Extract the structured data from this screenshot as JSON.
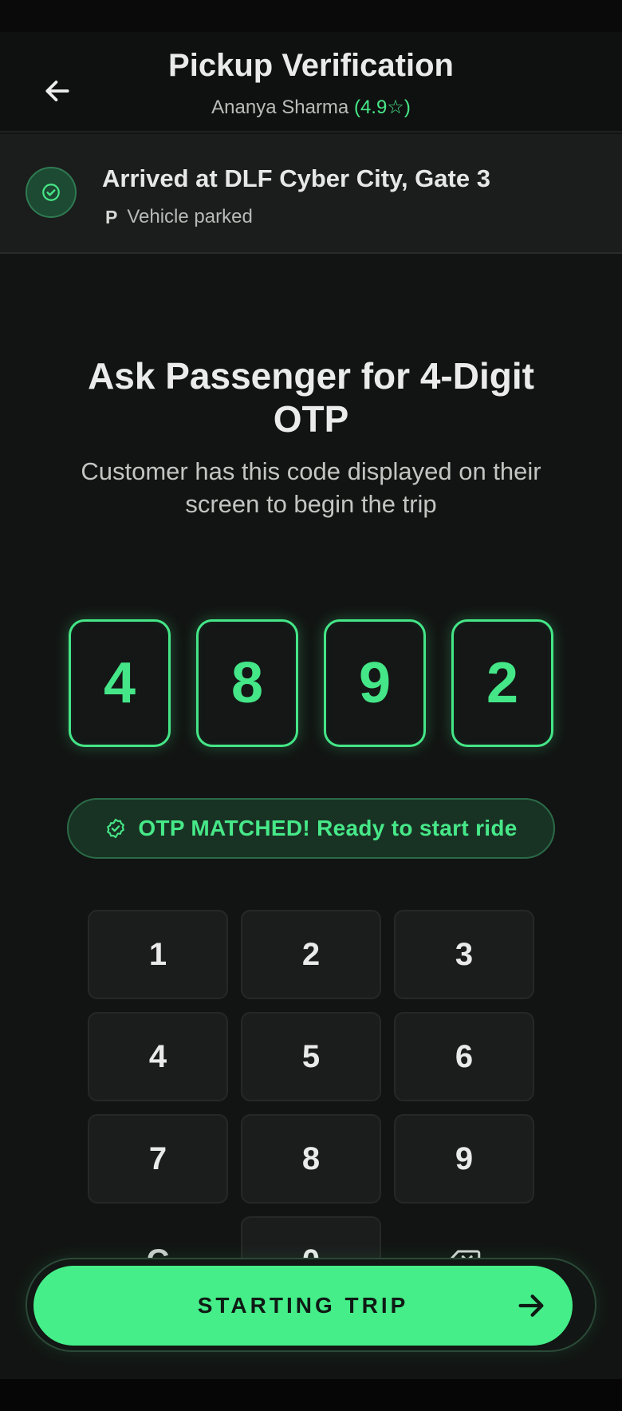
{
  "header": {
    "title": "Pickup Verification",
    "driver_name": "Ananya Sharma",
    "driver_rating": "(4.9☆)"
  },
  "arrival": {
    "title": "Arrived at DLF Cyber City, Gate 3",
    "parking_glyph": "P",
    "status": "Vehicle parked"
  },
  "prompt": {
    "title": "Ask Passenger for 4-Digit OTP",
    "description": "Customer has this code displayed on their screen to begin the trip"
  },
  "otp": {
    "digits": [
      "4",
      "8",
      "9",
      "2"
    ]
  },
  "match": {
    "message": "OTP MATCHED! Ready to start ride"
  },
  "keypad": {
    "keys": [
      "1",
      "2",
      "3",
      "4",
      "5",
      "6",
      "7",
      "8",
      "9",
      "C",
      "0"
    ]
  },
  "action": {
    "start_label": "STARTING TRIP"
  },
  "colors": {
    "accent": "#45ee89",
    "background": "#121413"
  },
  "icons": {
    "back": "arrow-left-icon",
    "arrival": "check-circle-icon",
    "match": "verified-badge-icon",
    "backspace": "backspace-icon",
    "start": "arrow-right-icon"
  }
}
